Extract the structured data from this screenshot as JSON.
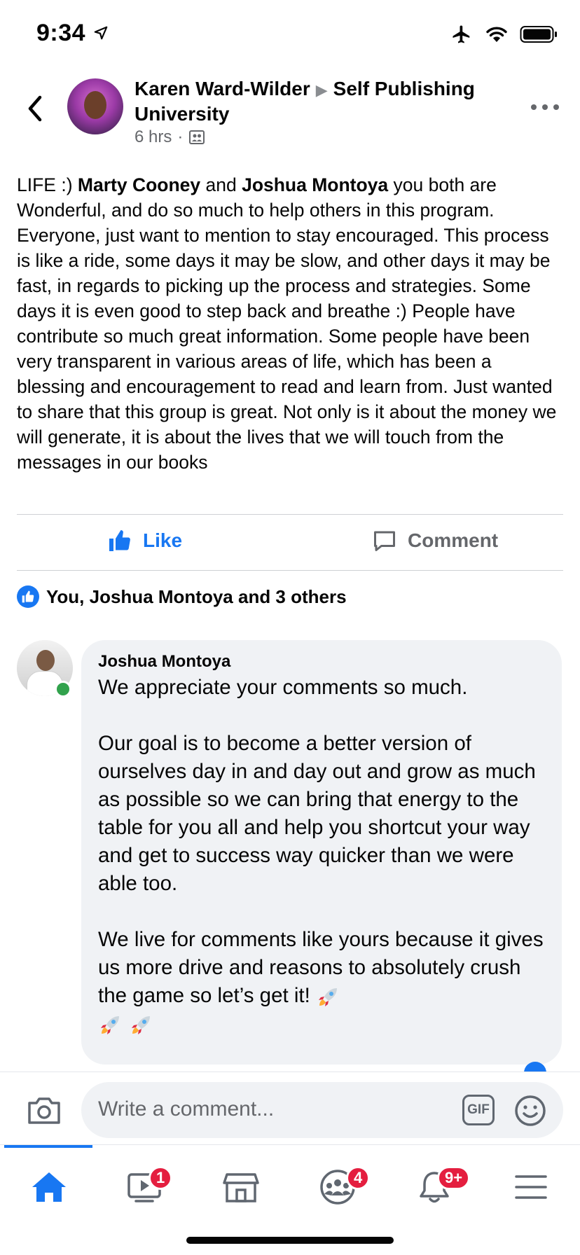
{
  "status_bar": {
    "time": "9:34",
    "icons": [
      "location-arrow-icon",
      "airplane-icon",
      "wifi-icon",
      "battery-icon"
    ]
  },
  "post": {
    "author": "Karen Ward-Wilder",
    "group": "Self Publishing University",
    "time_ago": "6 hrs",
    "separator": "·",
    "privacy_icon": "group-icon",
    "body_segments": [
      {
        "text": "LIFE :)  ",
        "bold": false
      },
      {
        "text": "Marty Cooney",
        "bold": true
      },
      {
        "text": " and ",
        "bold": false
      },
      {
        "text": "Joshua Montoya",
        "bold": true
      },
      {
        "text": " you both are Wonderful, and do so much to help others in this program. Everyone, just want to mention to stay encouraged. This process is like a ride, some days it may be slow, and other days it may be fast, in regards to picking up the process and strategies. Some days it is even good to step back and breathe :)  People have contribute so much great information. Some people have been very transparent in various areas of life, which has been a blessing and encouragement to read and learn from. Just wanted to share that this group is great. Not only is it about the money we will generate, it is about the lives that we will touch from the messages in our books",
        "bold": false
      }
    ]
  },
  "actions": {
    "like_label": "Like",
    "comment_label": "Comment"
  },
  "reactions": {
    "summary": "You, Joshua Montoya and 3 others"
  },
  "comment": {
    "author": "Joshua Montoya",
    "online": true,
    "paragraphs": [
      "We appreciate your comments so much.",
      "Our goal is to become a better version of ourselves day in and day out and grow as much as possible so we can bring that energy to the table for you all and help you shortcut your way and get to success way quicker than we were able too.",
      "We live for comments like yours because it gives us more drive and reasons to absolutely crush the game so let’s get it!"
    ],
    "emoji": "rocket-icon"
  },
  "composer": {
    "placeholder": "Write a comment...",
    "gif_label": "GIF"
  },
  "tab_bar": {
    "tabs": [
      {
        "name": "home",
        "icon": "home-icon",
        "badge": "",
        "active": true
      },
      {
        "name": "watch",
        "icon": "watch-icon",
        "badge": "1"
      },
      {
        "name": "marketplace",
        "icon": "marketplace-icon",
        "badge": ""
      },
      {
        "name": "groups",
        "icon": "groups-icon",
        "badge": "4"
      },
      {
        "name": "notifications",
        "icon": "bell-icon",
        "badge": "9+"
      },
      {
        "name": "menu",
        "icon": "menu-icon",
        "badge": ""
      }
    ]
  },
  "colors": {
    "accent": "#1877f2",
    "badge": "#e41e3f",
    "online": "#31a24c",
    "bubble": "#f0f2f5",
    "secondary_text": "#65676b"
  }
}
